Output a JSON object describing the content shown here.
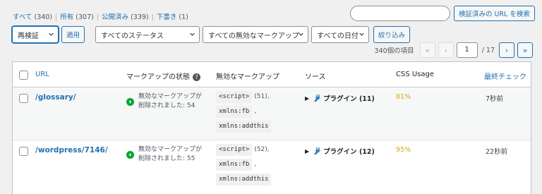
{
  "filters": {
    "all": {
      "label": "すべて",
      "count": "(340)"
    },
    "owned": {
      "label": "所有",
      "count": "(307)"
    },
    "published": {
      "label": "公開済み",
      "count": "(339)"
    },
    "draft": {
      "label": "下書き",
      "count": "(1)"
    },
    "separator": "|"
  },
  "search": {
    "placeholder": "",
    "button": "検証済みの URL を検索"
  },
  "bulk": {
    "selected": "再検証",
    "apply": "適用"
  },
  "status_filter": {
    "selected": "すべてのステータス"
  },
  "markup_filter": {
    "selected": "すべての無効なマークアップ"
  },
  "date_filter": {
    "selected": "すべての日付"
  },
  "filter_button": "絞り込み",
  "pagination": {
    "items": "340個の項目",
    "first": "«",
    "prev": "‹",
    "current": "1",
    "total": "/ 17",
    "next": "›",
    "last": "»"
  },
  "columns": {
    "url": "URL",
    "status": "マークアップの状態",
    "markup": "無効なマークアップ",
    "source": "ソース",
    "css": "CSS Usage",
    "last_checked": "最終チェック"
  },
  "rows": [
    {
      "url": "/glossary/",
      "status_line1": "無効なマークアップが",
      "status_line2": "削除されました: 54",
      "markup_script": "<script>",
      "markup_script_count": "(51),",
      "markup_fb": "xmlns:fb",
      "markup_fb_sep": ",",
      "markup_addthis": "xmlns:addthis",
      "source": "プラグイン (11)",
      "css": "81%",
      "last_checked": "7秒前"
    },
    {
      "url": "/wordpress/7146/",
      "status_line1": "無効なマークアップが",
      "status_line2": "削除されました: 55",
      "markup_script": "<script>",
      "markup_script_count": "(52),",
      "markup_fb": "xmlns:fb",
      "markup_fb_sep": ",",
      "markup_addthis": "xmlns:addthis",
      "source": "プラグイン (12)",
      "css": "95%",
      "last_checked": "22秒前"
    }
  ],
  "colors": {
    "link": "#2271b1",
    "success": "#00a32a",
    "warning": "#dba617",
    "source_icon": "#3582c4"
  },
  "icons": {
    "status": "check-circle-icon",
    "source": "plug-icon",
    "help": "help-icon",
    "toggle": "triangle-right-icon"
  }
}
